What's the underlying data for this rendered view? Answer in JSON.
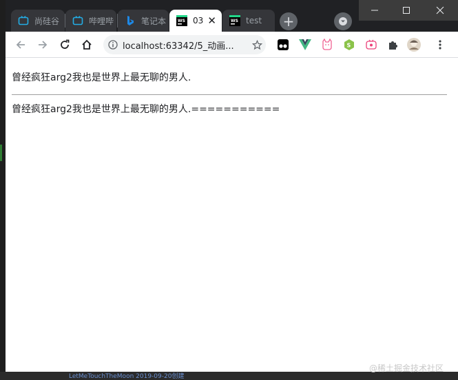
{
  "tabs": [
    {
      "label": "尚硅谷",
      "icon": "tv-icon",
      "active": false
    },
    {
      "label": "哔哩哔",
      "icon": "tv-icon",
      "active": false
    },
    {
      "label": "笔记本",
      "icon": "bing-icon",
      "active": false
    },
    {
      "label": "03",
      "icon": "webstorm-icon",
      "active": true
    },
    {
      "label": "test",
      "icon": "webstorm-icon",
      "active": false
    }
  ],
  "address_bar": {
    "url": "localhost:63342/5_动画..."
  },
  "content": {
    "line1": "曾经疯狂arg2我也是世界上最无聊的男人.",
    "line2": "曾经疯狂arg2我也是世界上最无聊的男人.==========="
  },
  "background": {
    "bottom_text": "LetMeTouchTheMoon  2019-09-20创建"
  },
  "watermark": "@稀土掘金技术社区",
  "colors": {
    "accent_green": "#2e7d32",
    "tab_bar": "#202124",
    "vue_green": "#42b883"
  }
}
